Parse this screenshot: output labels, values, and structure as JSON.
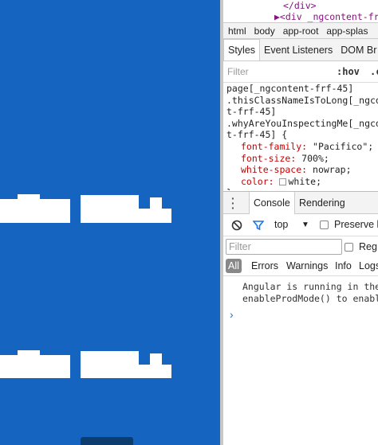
{
  "app": {
    "background": "#1565c0",
    "block_color": "#ffffff"
  },
  "devtools": {
    "dom_lines": [
      "</div>",
      "▶<div _ngcontent-frf"
    ],
    "breadcrumbs": [
      "html",
      "body",
      "app-root",
      "app-splas"
    ],
    "sub_tabs": [
      "Styles",
      "Event Listeners",
      "DOM Br"
    ],
    "styles_filter_placeholder": "Filter",
    "hov_label": ":hov",
    "cls_label": ".c",
    "styles_lines": [
      "page[_ngcontent-frf-45]",
      ".thisClassNameIsToLong[_ngco",
      "t-frf-45]",
      ".whyAreYouInspectingMe[_ngco",
      "t-frf-45] {"
    ],
    "props": [
      {
        "name": "font-family",
        "value": "\"Pacifico\";"
      },
      {
        "name": "font-size",
        "value": "700%;"
      },
      {
        "name": "white-space",
        "value": "nowrap;"
      },
      {
        "name": "color",
        "value": "white;"
      }
    ],
    "closing_brace": "}",
    "drawer_tabs": [
      "Console",
      "Rendering"
    ],
    "context": "top",
    "preserve_log": "Preserve l",
    "console_filter_placeholder": "Filter",
    "regex_label": "Reg",
    "levels": [
      "All",
      "Errors",
      "Warnings",
      "Info",
      "Logs"
    ],
    "log_lines": [
      "Angular is running in the",
      "enableProdMode() to enabl"
    ],
    "prompt": "›"
  }
}
